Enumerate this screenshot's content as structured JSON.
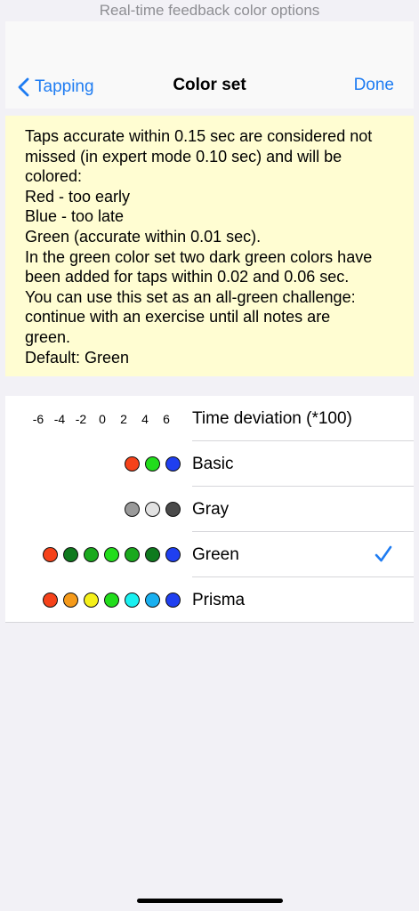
{
  "caption": "Real-time feedback color options",
  "nav": {
    "back_label": "Tapping",
    "title": "Color set",
    "done_label": "Done"
  },
  "info_lines": [
    "Taps accurate within 0.15 sec are considered not",
    "missed (in expert mode 0.10 sec) and will be",
    "colored:",
    "Red - too early",
    "Blue - too late",
    "Green (accurate within 0.01 sec).",
    "In the green color set two dark green colors have",
    "been added for taps within 0.02 and 0.06 sec.",
    "You can use this set as an all-green challenge:",
    "continue with an exercise until all notes are",
    "green.",
    "Default: Green"
  ],
  "header_row": {
    "ticks": [
      "-6",
      "-4",
      "-2",
      "0",
      "2",
      "4",
      "6"
    ],
    "label": "Time deviation (*100)"
  },
  "color_sets": [
    {
      "label": "Basic",
      "selected": false,
      "colors": [
        "#f5421a",
        "#22dd1c",
        "#1f3ff0"
      ]
    },
    {
      "label": "Gray",
      "selected": false,
      "colors": [
        "#9a9a9a",
        "#e2e2e2",
        "#4a4a4a"
      ]
    },
    {
      "label": "Green",
      "selected": true,
      "colors": [
        "#f5421a",
        "#0e7a1e",
        "#1aa91e",
        "#22dd1c",
        "#1aa91e",
        "#0e7a1e",
        "#1f3ff0"
      ]
    },
    {
      "label": "Prisma",
      "selected": false,
      "colors": [
        "#f5421a",
        "#f59a1a",
        "#f5f01a",
        "#22dd1c",
        "#1af0f0",
        "#19b0f0",
        "#1f3ff0"
      ]
    }
  ],
  "accent_color": "#1e7cf2"
}
